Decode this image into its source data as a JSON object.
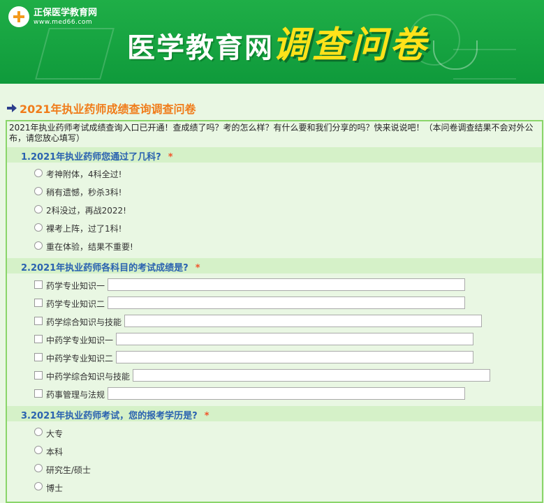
{
  "banner": {
    "logo_name": "正保医学教育网",
    "logo_url": "www.med66.com",
    "title": "医学教育网",
    "subtitle": "调查问卷"
  },
  "survey": {
    "title": "2021年执业药师成绩查询调查问卷",
    "intro": "2021年执业药师考试成绩查询入口已开通！查成绩了吗？考的怎么样？有什么要和我们分享的吗？快来说说吧！（本问卷调查结果不会对外公布，请您放心填写）",
    "required_mark": "*",
    "q1": {
      "label": "1.2021年执业药师您通过了几科?",
      "options": [
        "考神附体，4科全过!",
        "稍有遗憾，秒杀3科!",
        "2科没过，再战2022!",
        "裸考上阵，过了1科!",
        "重在体验，结果不重要!"
      ]
    },
    "q2": {
      "label": "2.2021年执业药师各科目的考试成绩是?",
      "options": [
        "药学专业知识一",
        "药学专业知识二",
        "药学综合知识与技能",
        "中药学专业知识一",
        "中药学专业知识二",
        "中药学综合知识与技能",
        "药事管理与法规"
      ]
    },
    "q3": {
      "label": "3.2021年执业药师考试，您的报考学历是?",
      "options": [
        "大专",
        "本科",
        "研究生/硕士",
        "博士"
      ]
    }
  }
}
